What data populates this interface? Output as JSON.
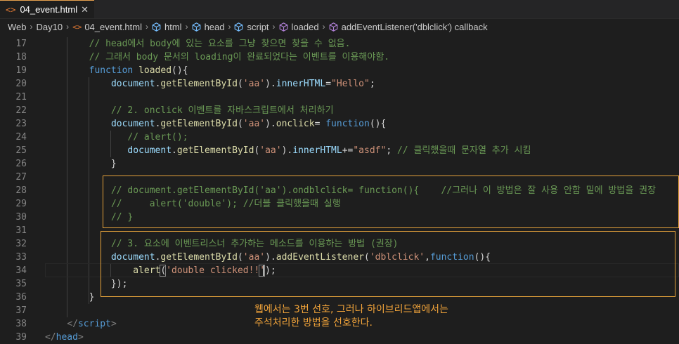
{
  "tab": {
    "title": "04_event.html",
    "close": "✕"
  },
  "breadcrumb": {
    "items": [
      "Web",
      "Day10",
      "04_event.html",
      "html",
      "head",
      "script",
      "loaded",
      "addEventListener('dblclick') callback"
    ]
  },
  "editor": {
    "lines": [
      {
        "no": "17",
        "tokens": [
          [
            "cm",
            "// head에서 body에 있는 요소를 그냥 찾으면 찾을 수 없음."
          ]
        ]
      },
      {
        "no": "18",
        "tokens": [
          [
            "cm",
            "// 그래서 body 문서의 loading이 완료되었다는 이벤트를 이용해야함."
          ]
        ]
      },
      {
        "no": "19",
        "tokens": [
          [
            "kw",
            "function"
          ],
          [
            "pn",
            " "
          ],
          [
            "fn",
            "loaded"
          ],
          [
            "pn",
            "(){"
          ]
        ]
      },
      {
        "no": "20",
        "tokens": [
          [
            "pn",
            "    "
          ],
          [
            "vr",
            "document"
          ],
          [
            "pn",
            "."
          ],
          [
            "fn",
            "getElementById"
          ],
          [
            "pn",
            "("
          ],
          [
            "st",
            "'aa'"
          ],
          [
            "pn",
            ")."
          ],
          [
            "vr",
            "innerHTML"
          ],
          [
            "pn",
            "="
          ],
          [
            "st",
            "\"Hello\""
          ],
          [
            "pn",
            ";"
          ]
        ]
      },
      {
        "no": "21",
        "tokens": []
      },
      {
        "no": "22",
        "tokens": [
          [
            "pn",
            "    "
          ],
          [
            "cm",
            "// 2. onclick 이벤트를 자바스크립트에서 처리하기"
          ]
        ]
      },
      {
        "no": "23",
        "tokens": [
          [
            "pn",
            "    "
          ],
          [
            "vr",
            "document"
          ],
          [
            "pn",
            "."
          ],
          [
            "fn",
            "getElementById"
          ],
          [
            "pn",
            "("
          ],
          [
            "st",
            "'aa'"
          ],
          [
            "pn",
            ")."
          ],
          [
            "fn",
            "onclick"
          ],
          [
            "pn",
            "= "
          ],
          [
            "kw",
            "function"
          ],
          [
            "pn",
            "(){"
          ]
        ]
      },
      {
        "no": "24",
        "tokens": [
          [
            "pn",
            "       "
          ],
          [
            "cm",
            "// alert();"
          ]
        ]
      },
      {
        "no": "25",
        "tokens": [
          [
            "pn",
            "       "
          ],
          [
            "vr",
            "document"
          ],
          [
            "pn",
            "."
          ],
          [
            "fn",
            "getElementById"
          ],
          [
            "pn",
            "("
          ],
          [
            "st",
            "'aa'"
          ],
          [
            "pn",
            ")."
          ],
          [
            "vr",
            "innerHTML"
          ],
          [
            "pn",
            "+="
          ],
          [
            "st",
            "\"asdf\""
          ],
          [
            "pn",
            "; "
          ],
          [
            "cm",
            "// 클릭했을때 문자열 추가 시킴"
          ]
        ]
      },
      {
        "no": "26",
        "tokens": [
          [
            "pn",
            "    }"
          ]
        ]
      },
      {
        "no": "27",
        "tokens": []
      },
      {
        "no": "28",
        "tokens": [
          [
            "pn",
            "    "
          ],
          [
            "cm",
            "// document.getElementById('aa').ondblclick= function(){    //그러나 이 방법은 잘 사용 안함 밑에 방법을 권장"
          ]
        ]
      },
      {
        "no": "29",
        "tokens": [
          [
            "pn",
            "    "
          ],
          [
            "cm",
            "//     alert('double'); //더블 클릭했을때 실행"
          ]
        ]
      },
      {
        "no": "30",
        "tokens": [
          [
            "pn",
            "    "
          ],
          [
            "cm",
            "// }"
          ]
        ]
      },
      {
        "no": "31",
        "tokens": []
      },
      {
        "no": "32",
        "tokens": [
          [
            "pn",
            "    "
          ],
          [
            "cm",
            "// 3. 요소에 이벤트리스너 추가하는 메소드를 이용하는 방법 (권장)"
          ]
        ]
      },
      {
        "no": "33",
        "tokens": [
          [
            "pn",
            "    "
          ],
          [
            "vr",
            "document"
          ],
          [
            "pn",
            "."
          ],
          [
            "fn",
            "getElementById"
          ],
          [
            "pn",
            "("
          ],
          [
            "st",
            "'aa'"
          ],
          [
            "pn",
            ")."
          ],
          [
            "fn",
            "addEventListener"
          ],
          [
            "pn",
            "("
          ],
          [
            "st",
            "'dblclick'"
          ],
          [
            "pn",
            ","
          ],
          [
            "kw",
            "function"
          ],
          [
            "pn",
            "(){"
          ]
        ]
      },
      {
        "no": "34",
        "tokens": [
          [
            "pn",
            "        "
          ],
          [
            "fn",
            "alert"
          ],
          [
            "pn",
            "("
          ],
          [
            "st",
            "'double clicked!!'"
          ],
          [
            "pn",
            ");"
          ]
        ]
      },
      {
        "no": "35",
        "tokens": [
          [
            "pn",
            "    });"
          ]
        ]
      },
      {
        "no": "36",
        "tokens": [
          [
            "pn",
            "}"
          ]
        ]
      },
      {
        "no": "37",
        "tokens": []
      },
      {
        "no": "38",
        "tokens": [
          [
            "pn",
            "    "
          ],
          [
            "tg",
            "</"
          ],
          [
            "tn",
            "script"
          ],
          [
            "tg",
            ">"
          ]
        ]
      },
      {
        "no": "39",
        "tokens": [
          [
            "tg",
            "</"
          ],
          [
            "tn",
            "head"
          ],
          [
            "tg",
            ">"
          ]
        ]
      }
    ]
  },
  "annotation": {
    "line1": "웹에서는 3번 선호, 그러나 하이브리드앱에서는",
    "line2": "주석처리한 방법을 선호한다."
  },
  "colors": {
    "background": "#1e1e1e",
    "comment": "#6a9955",
    "keyword": "#569cd6",
    "function": "#dcdcaa",
    "variable": "#9cdcfe",
    "string": "#ce9178",
    "highlight_box": "#e5a23b",
    "annotation_text": "#f2a43a"
  }
}
